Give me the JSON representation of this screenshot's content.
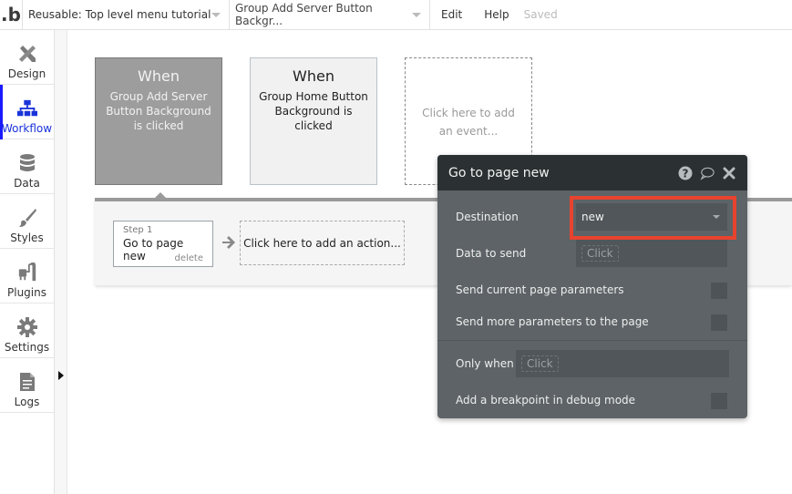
{
  "topbar": {
    "logo": ".b",
    "app_selector": "Reusable: Top level menu tutorial",
    "event_selector": "Group Add Server Button Backgr...",
    "menu": [
      "Edit",
      "Help"
    ],
    "status": "Saved"
  },
  "sidebar": {
    "items": [
      {
        "label": "Design",
        "icon": "design-icon",
        "active": false
      },
      {
        "label": "Workflow",
        "icon": "workflow-icon",
        "active": true
      },
      {
        "label": "Data",
        "icon": "database-icon",
        "active": false
      },
      {
        "label": "Styles",
        "icon": "brush-icon",
        "active": false
      },
      {
        "label": "Plugins",
        "icon": "plug-icon",
        "active": false
      },
      {
        "label": "Settings",
        "icon": "gear-icon",
        "active": false
      },
      {
        "label": "Logs",
        "icon": "document-icon",
        "active": false
      }
    ],
    "active_color": "#1a1aff"
  },
  "events": [
    {
      "when": "When",
      "description": "Group Add Server Button Background is clicked",
      "selected": true
    },
    {
      "when": "When",
      "description": "Group Home Button Background is clicked",
      "selected": false
    }
  ],
  "add_event": "Click here to add an event...",
  "actions": {
    "steps": [
      {
        "step_label": "Step 1",
        "title": "Go to page new",
        "delete_label": "delete"
      }
    ],
    "add_action": "Click here to add an action..."
  },
  "panel": {
    "title": "Go to page new",
    "icons": [
      "help-icon",
      "comment-icon",
      "close-icon"
    ],
    "destination_label": "Destination",
    "destination_value": "new",
    "data_to_send_label": "Data to send",
    "data_to_send_placeholder": "Click",
    "send_current_params_label": "Send current page parameters",
    "send_current_params_checked": false,
    "send_more_params_label": "Send more parameters to the page",
    "send_more_params_checked": false,
    "only_when_label": "Only when",
    "only_when_placeholder": "Click",
    "breakpoint_label": "Add a breakpoint in debug mode",
    "breakpoint_checked": false,
    "highlight_color": "#e8432e"
  }
}
